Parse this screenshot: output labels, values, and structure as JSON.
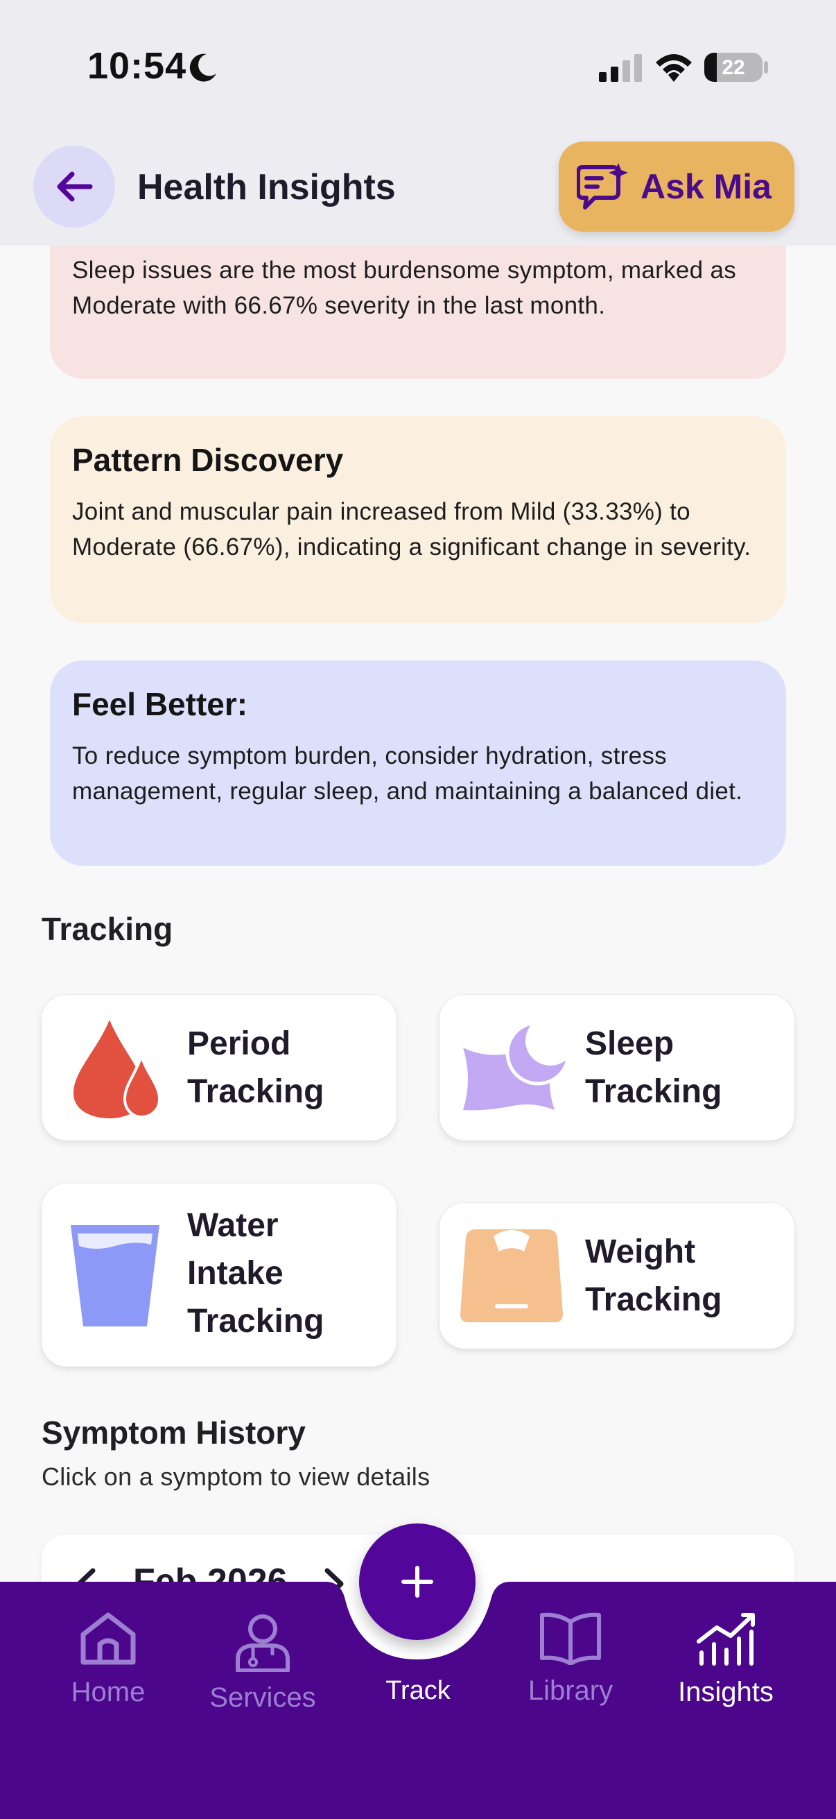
{
  "status_bar": {
    "time": "10:54",
    "battery": "22"
  },
  "header": {
    "title": "Health Insights",
    "ask_label": "Ask Mia"
  },
  "insights": [
    {
      "title": "",
      "text": "Sleep issues are the most burdensome symptom, marked as Moderate with 66.67% severity in the last month."
    },
    {
      "title": "Pattern Discovery",
      "text": "Joint and muscular pain increased from Mild (33.33%) to Moderate (66.67%), indicating a significant change in severity."
    },
    {
      "title": "Feel Better:",
      "text": "To reduce symptom burden, consider hydration, stress management, regular sleep, and maintaining a balanced diet."
    }
  ],
  "tracking": {
    "title": "Tracking",
    "items": [
      {
        "label": "Period\nTracking",
        "icon": "drop-icon"
      },
      {
        "label": "Sleep\nTracking",
        "icon": "pillow-moon-icon"
      },
      {
        "label": "Water\nIntake\nTracking",
        "icon": "water-glass-icon"
      },
      {
        "label": "Weight\nTracking",
        "icon": "scale-icon"
      }
    ]
  },
  "symptom_history": {
    "title": "Symptom History",
    "subtitle": "Click on a symptom to view details",
    "month": "Feb 2026"
  },
  "bottom_nav": {
    "items": [
      {
        "label": "Home",
        "icon": "home-icon"
      },
      {
        "label": "Services",
        "icon": "doctor-icon"
      },
      {
        "label": "Track",
        "icon": "plus-icon"
      },
      {
        "label": "Library",
        "icon": "book-icon"
      },
      {
        "label": "Insights",
        "icon": "chart-icon",
        "active": true
      }
    ]
  },
  "colors": {
    "brand": "#52069a",
    "accent": "#e8b460",
    "nav_bg": "#4b068c"
  }
}
